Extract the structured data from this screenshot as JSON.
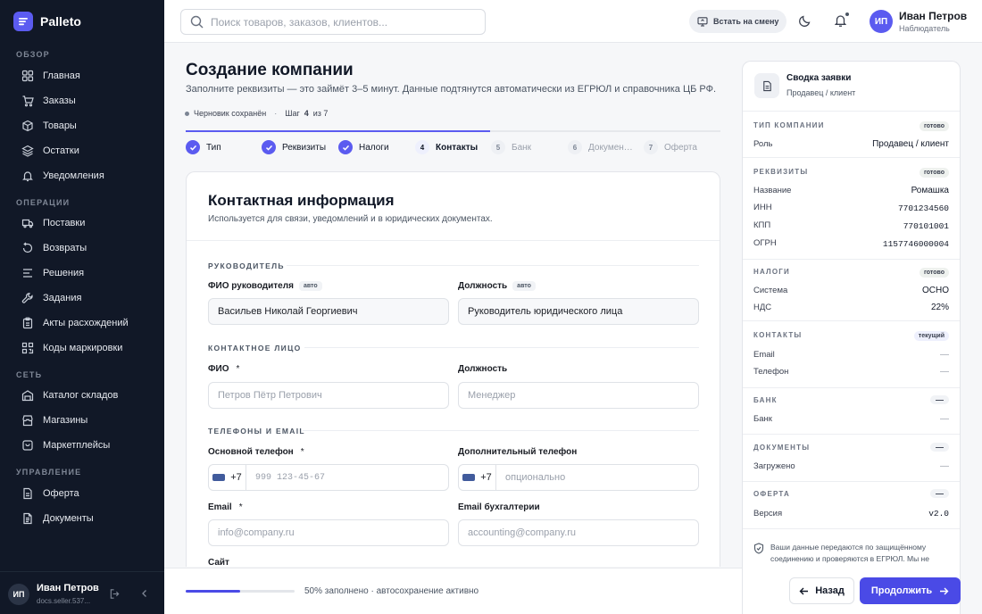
{
  "app": {
    "name": "Palleto"
  },
  "sidebar": {
    "sections": [
      {
        "label": "ОБЗОР",
        "items": [
          {
            "label": "Главная",
            "icon": "grid-icon"
          },
          {
            "label": "Заказы",
            "icon": "cart-icon"
          },
          {
            "label": "Товары",
            "icon": "package-icon"
          },
          {
            "label": "Остатки",
            "icon": "stack-icon"
          },
          {
            "label": "Уведомления",
            "icon": "bell-icon"
          }
        ]
      },
      {
        "label": "ОПЕРАЦИИ",
        "items": [
          {
            "label": "Поставки",
            "icon": "truck-icon"
          },
          {
            "label": "Возвраты",
            "icon": "return-icon"
          },
          {
            "label": "Решения",
            "icon": "list-icon"
          },
          {
            "label": "Задания",
            "icon": "wrench-icon"
          },
          {
            "label": "Акты расхождений",
            "icon": "clipboard-icon"
          },
          {
            "label": "Коды маркировки",
            "icon": "qr-icon"
          }
        ]
      },
      {
        "label": "СЕТЬ",
        "items": [
          {
            "label": "Каталог складов",
            "icon": "warehouse-icon"
          },
          {
            "label": "Магазины",
            "icon": "store-icon"
          },
          {
            "label": "Маркетплейсы",
            "icon": "marketplace-icon"
          }
        ]
      },
      {
        "label": "УПРАВЛЕНИЕ",
        "items": [
          {
            "label": "Оферта",
            "icon": "document-icon"
          },
          {
            "label": "Документы",
            "icon": "documents-icon"
          }
        ]
      }
    ],
    "user": {
      "initials": "ИП",
      "name": "Иван Петров",
      "email": "docs.seller.537..."
    }
  },
  "header": {
    "search_placeholder": "Поиск товаров, заказов, клиентов...",
    "shift_label": "Встать на смену",
    "user": {
      "initials": "ИП",
      "name": "Иван Петров",
      "role": "Наблюдатель"
    }
  },
  "page": {
    "title": "Создание компании",
    "subtitle": "Заполните реквизиты — это займёт 3–5 минут. Данные подтянутся автоматически из ЕГРЮЛ и справочника ЦБ РФ.",
    "draft_status": "Черновик сохранён",
    "step_prefix": "Шаг",
    "step_current": "4",
    "step_of": "из 7",
    "progress": 0.57,
    "steps": [
      {
        "num": "1",
        "label": "Тип",
        "state": "done"
      },
      {
        "num": "2",
        "label": "Реквизиты",
        "state": "done"
      },
      {
        "num": "3",
        "label": "Налоги",
        "state": "done"
      },
      {
        "num": "4",
        "label": "Контакты",
        "state": "current"
      },
      {
        "num": "5",
        "label": "Банк",
        "state": "todo"
      },
      {
        "num": "6",
        "label": "Докумен…",
        "state": "todo"
      },
      {
        "num": "7",
        "label": "Оферта",
        "state": "todo"
      }
    ]
  },
  "form": {
    "title": "Контактная информация",
    "subtitle": "Используется для связи, уведомлений и в юридических документах.",
    "auto_tag": "авто",
    "required_mark": "*",
    "head_section": "РУКОВОДИТЕЛЬ",
    "head_name_label": "ФИО руководителя",
    "head_name_value": "Васильев Николай Георгиевич",
    "head_position_label": "Должность",
    "head_position_value": "Руководитель юридического лица",
    "contact_section": "КОНТАКТНОЕ ЛИЦО",
    "contact_name_label": "ФИО",
    "contact_name_placeholder": "Петров Пётр Петрович",
    "contact_position_label": "Должность",
    "contact_position_placeholder": "Менеджер",
    "phones_section": "ТЕЛЕФОНЫ И EMAIL",
    "main_phone_label": "Основной телефон",
    "main_phone_code": "+7",
    "main_phone_placeholder": "999 123-45-67",
    "extra_phone_label": "Дополнительный телефон",
    "extra_phone_code": "+7",
    "extra_phone_placeholder": "опционально",
    "email_label": "Email",
    "email_placeholder": "info@company.ru",
    "acc_email_label": "Email бухгалтерии",
    "acc_email_placeholder": "accounting@company.ru",
    "site_label": "Сайт"
  },
  "footer": {
    "fill_percent": 50,
    "status": "50% заполнено · автосохранение активно",
    "back_label": "Назад",
    "next_label": "Продолжить"
  },
  "summary": {
    "title": "Сводка заявки",
    "subtitle": "Продавец / клиент",
    "company_type": {
      "label": "ТИП КОМПАНИИ",
      "badge": "готово",
      "role_key": "Роль",
      "role_val": "Продавец / клиент"
    },
    "requisites": {
      "label": "РЕКВИЗИТЫ",
      "badge": "готово",
      "rows": [
        {
          "key": "Название",
          "val": "Ромашка"
        },
        {
          "key": "ИНН",
          "val": "7701234560"
        },
        {
          "key": "КПП",
          "val": "770101001"
        },
        {
          "key": "ОГРН",
          "val": "1157746000004"
        }
      ]
    },
    "taxes": {
      "label": "НАЛОГИ",
      "badge": "готово",
      "rows": [
        {
          "key": "Система",
          "val": "ОСНО"
        },
        {
          "key": "НДС",
          "val": "22%"
        }
      ]
    },
    "contacts": {
      "label": "КОНТАКТЫ",
      "badge": "текущий",
      "rows": [
        {
          "key": "Email",
          "val": "—"
        },
        {
          "key": "Телефон",
          "val": "—"
        }
      ]
    },
    "bank": {
      "label": "БАНК",
      "badge": "—",
      "key": "Банк",
      "val": "—"
    },
    "documents": {
      "label": "ДОКУМЕНТЫ",
      "badge": "—",
      "key": "Загружено",
      "val": "—"
    },
    "offer": {
      "label": "ОФЕРТА",
      "badge": "—",
      "key": "Версия",
      "val": "v2.0"
    },
    "secure_note": "Ваши данные передаются по защищённому соединению и проверяются в ЕГРЮЛ. Мы не"
  }
}
